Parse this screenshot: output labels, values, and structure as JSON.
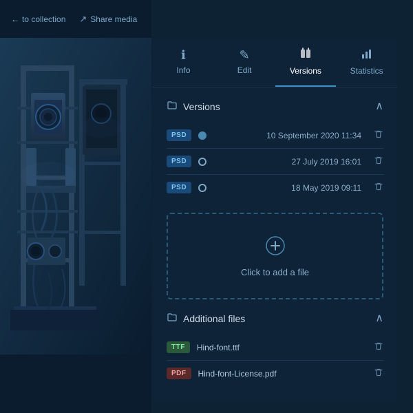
{
  "left_panel": {
    "back_link": "to collection",
    "share_media": "Share media"
  },
  "tabs": [
    {
      "id": "info",
      "label": "Info",
      "icon": "ℹ"
    },
    {
      "id": "edit",
      "label": "Edit",
      "icon": "✏"
    },
    {
      "id": "versions",
      "label": "Versions",
      "icon": "⇄"
    },
    {
      "id": "statistics",
      "label": "Statistics",
      "icon": "▥"
    }
  ],
  "active_tab": "versions",
  "versions_section": {
    "title": "Versions",
    "collapse_icon": "∧",
    "versions": [
      {
        "type": "PSD",
        "active": true,
        "date": "10 September 2020 11:34"
      },
      {
        "type": "PSD",
        "active": false,
        "date": "27 July 2019 16:01"
      },
      {
        "type": "PSD",
        "active": false,
        "date": "18 May 2019 09:11"
      }
    ]
  },
  "add_file": {
    "icon": "+",
    "label": "Click to add a file"
  },
  "additional_files_section": {
    "title": "Additional files",
    "collapse_icon": "∧",
    "files": [
      {
        "type": "TTF",
        "name": "Hind-font.ttf"
      },
      {
        "type": "PDF",
        "name": "Hind-font-License.pdf"
      }
    ]
  },
  "colors": {
    "bg_dark": "#0d2233",
    "bg_panel": "#0f2338",
    "accent": "#3a8fc4",
    "text_muted": "#7da8c8"
  }
}
